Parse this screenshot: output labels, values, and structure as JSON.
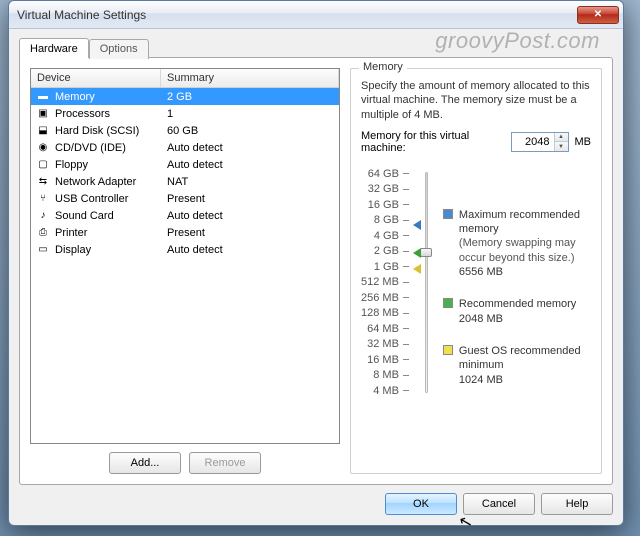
{
  "window": {
    "title": "Virtual Machine Settings"
  },
  "tabs": {
    "hardware": "Hardware",
    "options": "Options"
  },
  "columns": {
    "device": "Device",
    "summary": "Summary"
  },
  "devices": [
    {
      "name": "Memory",
      "summary": "2 GB",
      "icon": "memory"
    },
    {
      "name": "Processors",
      "summary": "1",
      "icon": "cpu"
    },
    {
      "name": "Hard Disk (SCSI)",
      "summary": "60 GB",
      "icon": "hdd"
    },
    {
      "name": "CD/DVD (IDE)",
      "summary": "Auto detect",
      "icon": "cd"
    },
    {
      "name": "Floppy",
      "summary": "Auto detect",
      "icon": "floppy"
    },
    {
      "name": "Network Adapter",
      "summary": "NAT",
      "icon": "net"
    },
    {
      "name": "USB Controller",
      "summary": "Present",
      "icon": "usb"
    },
    {
      "name": "Sound Card",
      "summary": "Auto detect",
      "icon": "sound"
    },
    {
      "name": "Printer",
      "summary": "Present",
      "icon": "printer"
    },
    {
      "name": "Display",
      "summary": "Auto detect",
      "icon": "display"
    }
  ],
  "buttons": {
    "add": "Add...",
    "remove": "Remove",
    "ok": "OK",
    "cancel": "Cancel",
    "help": "Help"
  },
  "memory": {
    "group": "Memory",
    "desc": "Specify the amount of memory allocated to this virtual machine. The memory size must be a multiple of 4 MB.",
    "label": "Memory for this virtual machine:",
    "value": "2048",
    "unit": "MB",
    "ticks": [
      "64 GB",
      "32 GB",
      "16 GB",
      "8 GB",
      "4 GB",
      "2 GB",
      "1 GB",
      "512 MB",
      "256 MB",
      "128 MB",
      "64 MB",
      "32 MB",
      "16 MB",
      "8 MB",
      "4 MB"
    ],
    "max_label": "Maximum recommended memory",
    "max_note": "(Memory swapping may occur beyond this size.)",
    "max_value": "6556 MB",
    "rec_label": "Recommended memory",
    "rec_value": "2048 MB",
    "min_label": "Guest OS recommended minimum",
    "min_value": "1024 MB"
  },
  "watermark": "groovyPost.com"
}
